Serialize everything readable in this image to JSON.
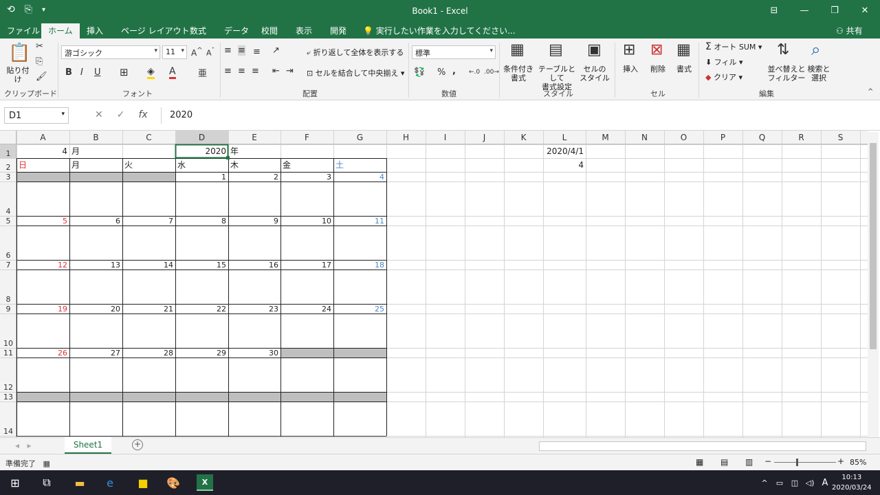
{
  "titlebar": {
    "title": "Book1 - Excel",
    "qat_save": "⟲",
    "qat_undo": "⎘",
    "qat_more": "▾"
  },
  "tabs": [
    "ファイル",
    "ホーム",
    "挿入",
    "ページ レイアウト",
    "数式",
    "データ",
    "校閲",
    "表示",
    "開発"
  ],
  "tell_me": "実行したい作業を入力してください...",
  "share": "共有",
  "ribbon": {
    "clipboard": {
      "label": "クリップボード",
      "paste": "貼り付け"
    },
    "font": {
      "label": "フォント",
      "font_name": "游ゴシック",
      "font_size": "11",
      "bold": "B",
      "italic": "I",
      "underline": "U"
    },
    "alignment": {
      "label": "配置",
      "wrap": "折り返して全体を表示する",
      "merge": "セルを結合して中央揃え"
    },
    "number": {
      "label": "数値",
      "format": "標準",
      "percent": "%",
      "comma": ","
    },
    "styles": {
      "label": "スタイル",
      "cond": "条件付き\n書式",
      "table": "テーブルとして\n書式設定",
      "cell": "セルの\nスタイル"
    },
    "cells": {
      "label": "セル",
      "insert": "挿入",
      "delete": "削除",
      "format": "書式"
    },
    "editing": {
      "label": "編集",
      "autosum": "オート SUM",
      "fill": "フィル",
      "clear": "クリア",
      "sort": "並べ替えと\nフィルター",
      "find": "検索と\n選択"
    }
  },
  "formula_bar": {
    "name_box": "D1",
    "cancel": "✕",
    "enter": "✓",
    "fx": "fx",
    "value": "2020"
  },
  "grid": {
    "columns": [
      "A",
      "B",
      "C",
      "D",
      "E",
      "F",
      "G",
      "H",
      "I",
      "J",
      "K",
      "L",
      "M",
      "N",
      "O",
      "P",
      "Q",
      "R",
      "S"
    ],
    "rows": [
      "1",
      "2",
      "3",
      "4",
      "5",
      "6",
      "7",
      "8",
      "9",
      "10",
      "11",
      "12",
      "13",
      "14"
    ],
    "selected_cell": "D1",
    "cells": {
      "A1": "4",
      "B1": "月",
      "D1": "2020",
      "E1": "年",
      "A2": "日",
      "B2": "月",
      "C2": "火",
      "D2": "水",
      "E2": "木",
      "F2": "金",
      "G2": "土",
      "L1": "2020/4/1",
      "L2": "4"
    },
    "weeks": [
      [
        "",
        "",
        "",
        "1",
        "2",
        "3",
        "4"
      ],
      [
        "5",
        "6",
        "7",
        "8",
        "9",
        "10",
        "11"
      ],
      [
        "12",
        "13",
        "14",
        "15",
        "16",
        "17",
        "18"
      ],
      [
        "19",
        "20",
        "21",
        "22",
        "23",
        "24",
        "25"
      ],
      [
        "26",
        "27",
        "28",
        "29",
        "30",
        "",
        ""
      ]
    ],
    "colors": {
      "sunday": "#e03030",
      "saturday": "#4a86c8",
      "gray_fill": "#bfbfbf",
      "gridline": "#d4d4d4"
    }
  },
  "sheet_tab": "Sheet1",
  "status": {
    "ready": "準備完了",
    "zoom": "85%"
  },
  "taskbar": {
    "time": "10:13",
    "date": "2020/03/24",
    "ime": "A"
  }
}
